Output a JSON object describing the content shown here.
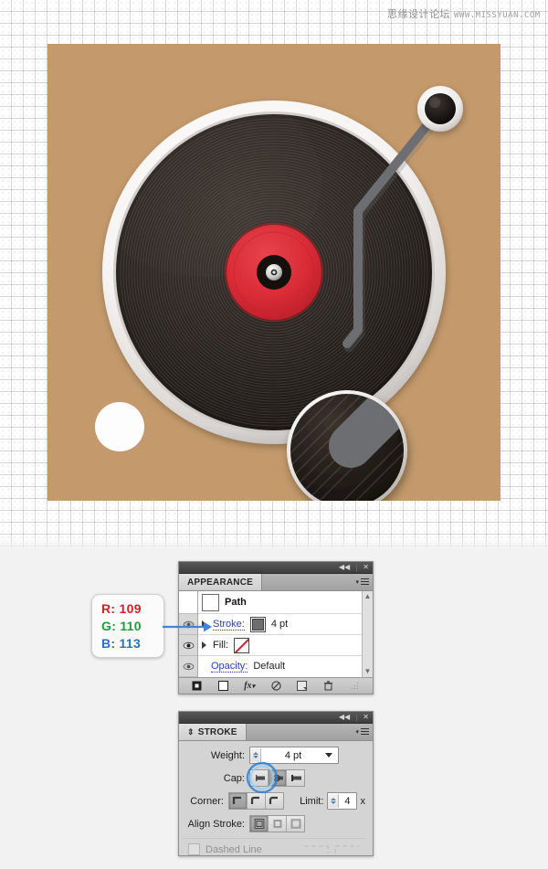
{
  "watermark": {
    "cn": "思缘设计论坛",
    "url": "WWW.MISSYUAN.COM"
  },
  "artwork": {
    "name": "vinyl-record-turntable-illustration",
    "background_color": "#c49a6c",
    "record_label_color": "#d92b36",
    "record_color": "#2b2521",
    "rim_color": "#f2f0ee",
    "tonearm_color": "#6d6e71",
    "white_dot_color": "#fdfdfd"
  },
  "rgb_callout": {
    "r": "R: 109",
    "g": "G: 110",
    "b": "B: 113",
    "hex": "#6D6E71"
  },
  "appearance_panel": {
    "tab_label": "APPEARANCE",
    "rows": [
      {
        "label": "Path",
        "type": "object"
      },
      {
        "label": "Stroke:",
        "value": "4 pt",
        "type": "stroke"
      },
      {
        "label": "Fill:",
        "value": "",
        "type": "fill"
      },
      {
        "label": "Opacity:",
        "value": "Default",
        "type": "opacity"
      }
    ],
    "footer_icons": [
      "add-new-stroke-icon",
      "add-new-fill-icon",
      "add-new-effect-icon",
      "clear-appearance-icon",
      "duplicate-item-icon",
      "delete-item-icon"
    ]
  },
  "stroke_panel": {
    "tab_label": "STROKE",
    "weight_label": "Weight:",
    "weight_value": "4 pt",
    "cap_label": "Cap:",
    "cap_options": [
      "butt-cap",
      "round-cap",
      "projecting-cap"
    ],
    "cap_selected_index": 1,
    "corner_label": "Corner:",
    "corner_options": [
      "miter-join",
      "round-join",
      "bevel-join"
    ],
    "corner_selected_index": 0,
    "limit_label": "Limit:",
    "limit_value": "4",
    "limit_unit": "x",
    "align_label": "Align Stroke:",
    "align_options": [
      "align-center",
      "align-inside",
      "align-outside"
    ],
    "align_selected_index": 0,
    "dashed_label": "Dashed Line",
    "dashed_checked": false
  }
}
